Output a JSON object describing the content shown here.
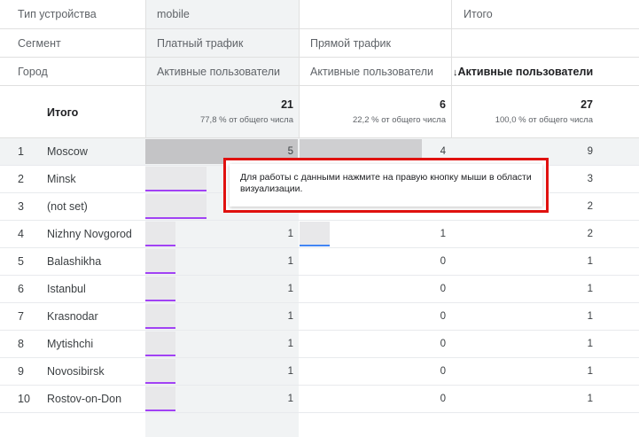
{
  "header": {
    "device_label": "Тип устройства",
    "device_value": "mobile",
    "total_label": "Итого",
    "segment_label": "Сегмент",
    "segment_1": "Платный трафик",
    "segment_2": "Прямой трафик",
    "city_label": "Город",
    "metric_1": "Активные пользователи",
    "metric_2": "Активные пользователи",
    "sort_arrow": "↓",
    "metric_total": "Активные пользователи"
  },
  "totals": {
    "label": "Итого",
    "paid": "21",
    "paid_pct": "77,8 % от общего числа",
    "direct": "6",
    "direct_pct": "22,2 % от общего числа",
    "all": "27",
    "all_pct": "100,0 % от общего числа"
  },
  "rows": [
    {
      "idx": "1",
      "city": "Moscow",
      "paid": "5",
      "direct": "4",
      "total": "9"
    },
    {
      "idx": "2",
      "city": "Minsk",
      "paid": "",
      "direct": "",
      "total": "3"
    },
    {
      "idx": "3",
      "city": "(not set)",
      "paid": "",
      "direct": "",
      "total": "2"
    },
    {
      "idx": "4",
      "city": "Nizhny Novgorod",
      "paid": "1",
      "direct": "1",
      "total": "2"
    },
    {
      "idx": "5",
      "city": "Balashikha",
      "paid": "1",
      "direct": "0",
      "total": "1"
    },
    {
      "idx": "6",
      "city": "Istanbul",
      "paid": "1",
      "direct": "0",
      "total": "1"
    },
    {
      "idx": "7",
      "city": "Krasnodar",
      "paid": "1",
      "direct": "0",
      "total": "1"
    },
    {
      "idx": "8",
      "city": "Mytishchi",
      "paid": "1",
      "direct": "0",
      "total": "1"
    },
    {
      "idx": "9",
      "city": "Novosibirsk",
      "paid": "1",
      "direct": "0",
      "total": "1"
    },
    {
      "idx": "10",
      "city": "Rostov-on-Don",
      "paid": "1",
      "direct": "0",
      "total": "1"
    }
  ],
  "bar_fractions": {
    "paid": [
      1.0,
      0.4,
      0.4,
      0.2,
      0.2,
      0.2,
      0.2,
      0.2,
      0.2,
      0.2
    ],
    "direct": [
      0.8,
      0,
      0,
      0.2,
      0,
      0,
      0,
      0,
      0,
      0
    ]
  },
  "tooltip": {
    "text": "Для работы с данными нажмите на правую кнопку мыши в области визуализации."
  },
  "colors": {
    "paid_bar_accent": "#a142f4",
    "direct_bar_accent": "#4285f4",
    "tooltip_highlight": "#e0110f"
  }
}
